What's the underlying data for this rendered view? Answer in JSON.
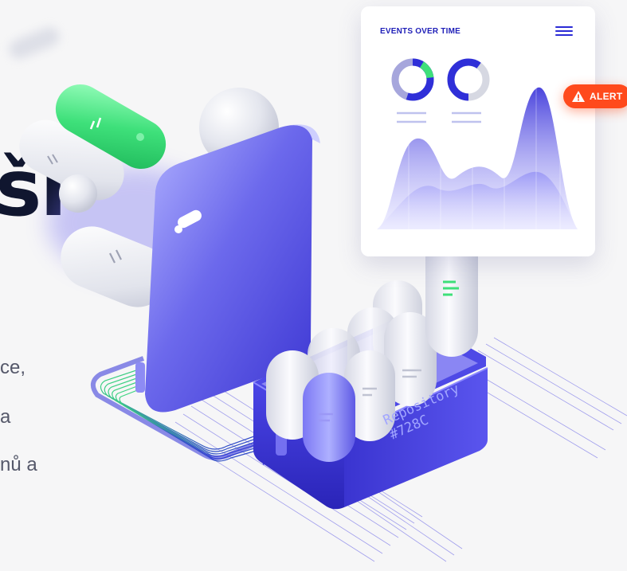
{
  "hero": {
    "heading_fragment": "ší",
    "text_lines": [
      "ce,",
      "a",
      "nů a"
    ]
  },
  "events_card": {
    "title": "EVENTS OVER TIME",
    "donuts": [
      {
        "fill_fraction": 0.75,
        "accent_fraction": 0.2,
        "primary_color": "#2f2fd8",
        "secondary_color": "#a6a6dc",
        "accent_color": "#3ee07a"
      },
      {
        "fill_fraction": 0.6,
        "accent_fraction": 0.0,
        "primary_color": "#2f2fd8",
        "secondary_color": "#d6d8e2"
      }
    ],
    "area_color": "#5a55e0"
  },
  "alert": {
    "label": "ALERT",
    "color": "#ff4a1c"
  },
  "repository": {
    "line1": "Repository",
    "line2": "#728C"
  },
  "colors": {
    "background": "#f6f6f7",
    "accent": "#2f2fd8",
    "green": "#3ee07a",
    "heading": "#10162f"
  }
}
